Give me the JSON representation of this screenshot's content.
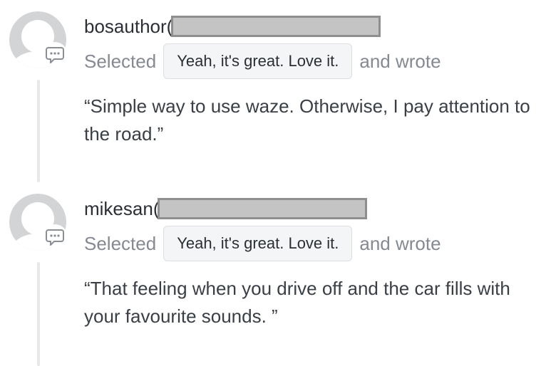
{
  "feed": {
    "entries": [
      {
        "username": "bosauthor(",
        "selected_prefix": "Selected",
        "choice": "Yeah, it's great. Love it.",
        "selected_suffix": "and wrote",
        "comment": "“Simple way to use waze. Otherwise, I pay attention to the road.”"
      },
      {
        "username": "mikesan(",
        "selected_prefix": "Selected",
        "choice": "Yeah, it's great. Love it.",
        "selected_suffix": "and wrote",
        "comment": "“That feeling when you drive off and the car fills with your favourite sounds. ”"
      }
    ]
  },
  "colors": {
    "avatar_gray": "#d3d4d6",
    "timeline_line": "#e7e8ea",
    "muted_text": "#858991",
    "chip_background": "#f4f5f6",
    "redaction_fill": "#c4c4c4",
    "redaction_border": "#8f8f8f"
  },
  "icons": {
    "avatar": "default-avatar-icon",
    "comment": "comment-bubble-icon"
  }
}
